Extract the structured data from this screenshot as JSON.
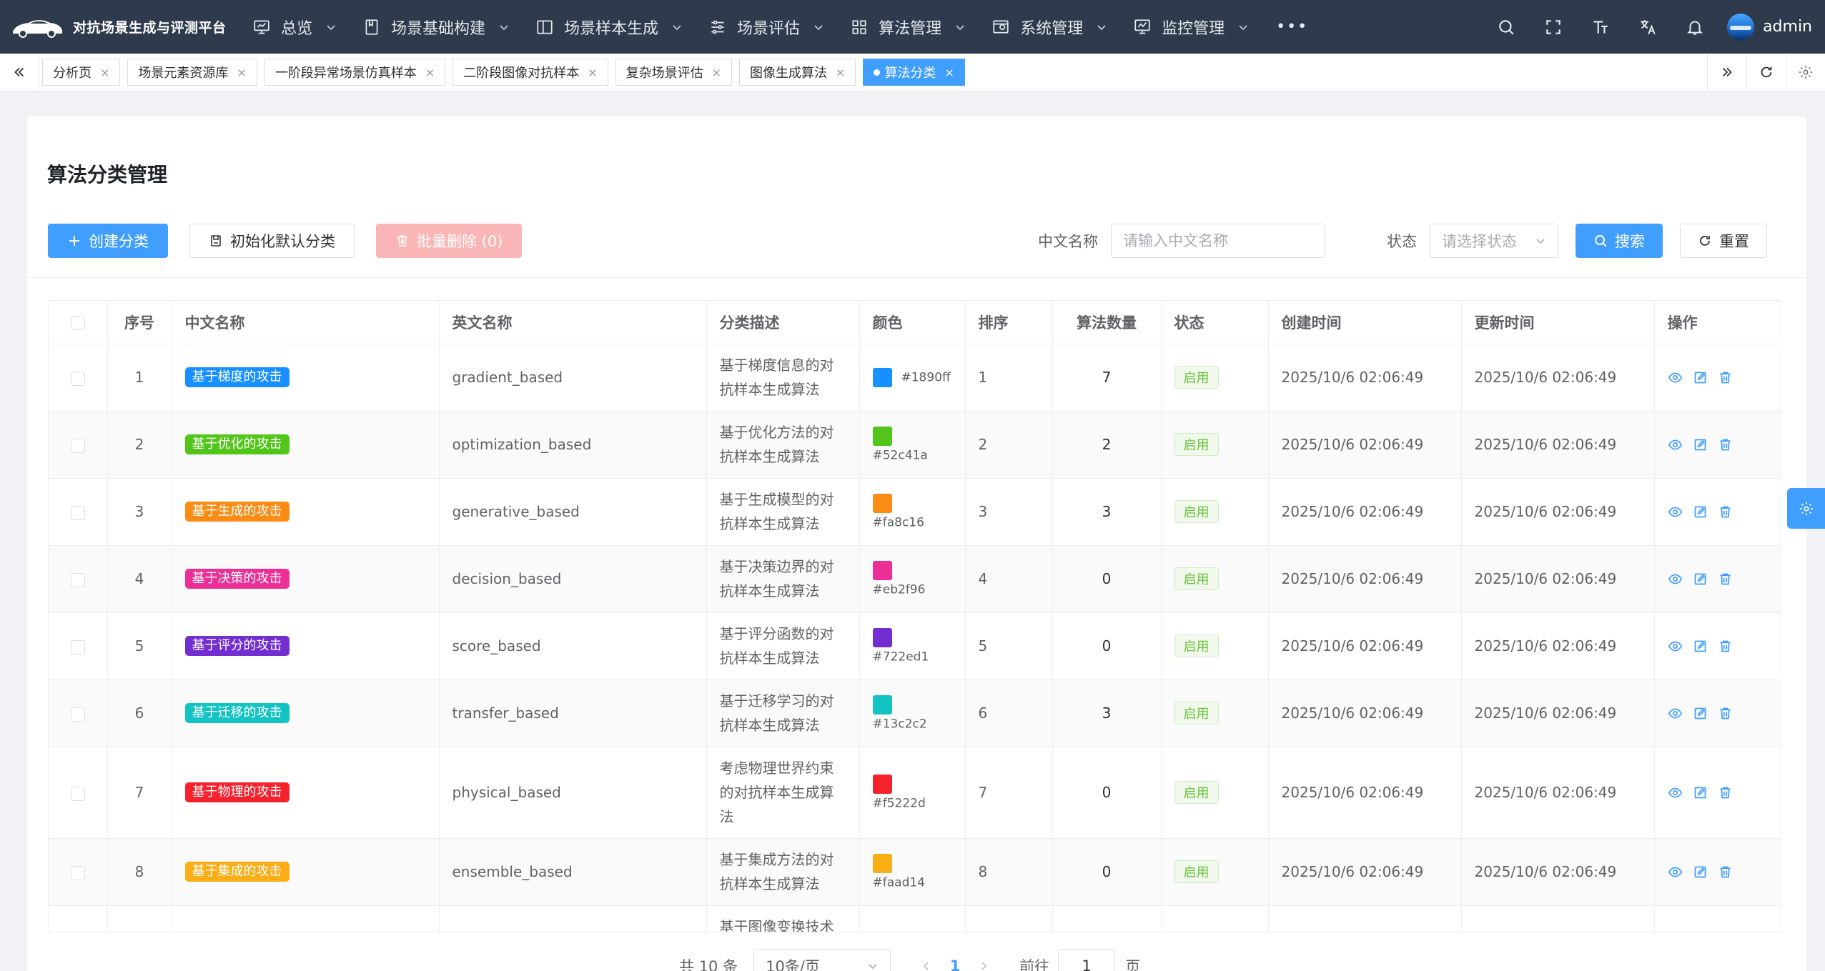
{
  "app": {
    "title": "对抗场景生成与评测平台",
    "username": "admin"
  },
  "menu": [
    {
      "label": "总览",
      "icon": "monitor-icon"
    },
    {
      "label": "场景基础构建",
      "icon": "book-icon"
    },
    {
      "label": "场景样本生成",
      "icon": "layout-icon"
    },
    {
      "label": "场景评估",
      "icon": "sliders-icon"
    },
    {
      "label": "算法管理",
      "icon": "grid-icon"
    },
    {
      "label": "系统管理",
      "icon": "settings-window-icon"
    },
    {
      "label": "监控管理",
      "icon": "chart-monitor-icon"
    }
  ],
  "menu_more": "•••",
  "tabs": [
    {
      "label": "分析页",
      "active": false
    },
    {
      "label": "场景元素资源库",
      "active": false
    },
    {
      "label": "一阶段异常场景仿真样本",
      "active": false
    },
    {
      "label": "二阶段图像对抗样本",
      "active": false
    },
    {
      "label": "复杂场景评估",
      "active": false
    },
    {
      "label": "图像生成算法",
      "active": false
    },
    {
      "label": "算法分类",
      "active": true
    }
  ],
  "tab_close": "×",
  "page": {
    "title": "算法分类管理",
    "buttons": {
      "create": "创建分类",
      "init": "初始化默认分类",
      "batch_delete": "批量删除 (0)"
    },
    "search": {
      "name_label": "中文名称",
      "name_placeholder": "请输入中文名称",
      "status_label": "状态",
      "status_placeholder": "请选择状态",
      "search_btn": "搜索",
      "reset_btn": "重置"
    }
  },
  "table": {
    "headers": [
      "序号",
      "中文名称",
      "英文名称",
      "分类描述",
      "颜色",
      "排序",
      "算法数量",
      "状态",
      "创建时间",
      "更新时间",
      "操作"
    ],
    "rows": [
      {
        "no": "1",
        "name": "基于梯度的攻击",
        "en": "gradient_based",
        "desc": "基于梯度信息的对抗样本生成算法",
        "color": "#1890ff",
        "sort": "1",
        "count": "7",
        "status": "启用",
        "created": "2025/10/6 02:06:49",
        "updated": "2025/10/6 02:06:49"
      },
      {
        "no": "2",
        "name": "基于优化的攻击",
        "en": "optimization_based",
        "desc": "基于优化方法的对抗样本生成算法",
        "color": "#52c41a",
        "sort": "2",
        "count": "2",
        "status": "启用",
        "created": "2025/10/6 02:06:49",
        "updated": "2025/10/6 02:06:49"
      },
      {
        "no": "3",
        "name": "基于生成的攻击",
        "en": "generative_based",
        "desc": "基于生成模型的对抗样本生成算法",
        "color": "#fa8c16",
        "sort": "3",
        "count": "3",
        "status": "启用",
        "created": "2025/10/6 02:06:49",
        "updated": "2025/10/6 02:06:49"
      },
      {
        "no": "4",
        "name": "基于决策的攻击",
        "en": "decision_based",
        "desc": "基于决策边界的对抗样本生成算法",
        "color": "#eb2f96",
        "sort": "4",
        "count": "0",
        "status": "启用",
        "created": "2025/10/6 02:06:49",
        "updated": "2025/10/6 02:06:49"
      },
      {
        "no": "5",
        "name": "基于评分的攻击",
        "en": "score_based",
        "desc": "基于评分函数的对抗样本生成算法",
        "color": "#722ed1",
        "sort": "5",
        "count": "0",
        "status": "启用",
        "created": "2025/10/6 02:06:49",
        "updated": "2025/10/6 02:06:49"
      },
      {
        "no": "6",
        "name": "基于迁移的攻击",
        "en": "transfer_based",
        "desc": "基于迁移学习的对抗样本生成算法",
        "color": "#13c2c2",
        "sort": "6",
        "count": "3",
        "status": "启用",
        "created": "2025/10/6 02:06:49",
        "updated": "2025/10/6 02:06:49"
      },
      {
        "no": "7",
        "name": "基于物理的攻击",
        "en": "physical_based",
        "desc": "考虑物理世界约束的对抗样本生成算法",
        "color": "#f5222d",
        "sort": "7",
        "count": "0",
        "status": "启用",
        "created": "2025/10/6 02:06:49",
        "updated": "2025/10/6 02:06:49"
      },
      {
        "no": "8",
        "name": "基于集成的攻击",
        "en": "ensemble_based",
        "desc": "基于集成方法的对抗样本生成算法",
        "color": "#faad14",
        "sort": "8",
        "count": "0",
        "status": "启用",
        "created": "2025/10/6 02:06:49",
        "updated": "2025/10/6 02:06:49"
      }
    ],
    "partial_row_desc": "基于图像变换技术"
  },
  "pagination": {
    "total": "共 10 条",
    "page_size": "10条/页",
    "current": "1",
    "goto_label": "前往",
    "goto_value": "1",
    "page_unit": "页"
  }
}
